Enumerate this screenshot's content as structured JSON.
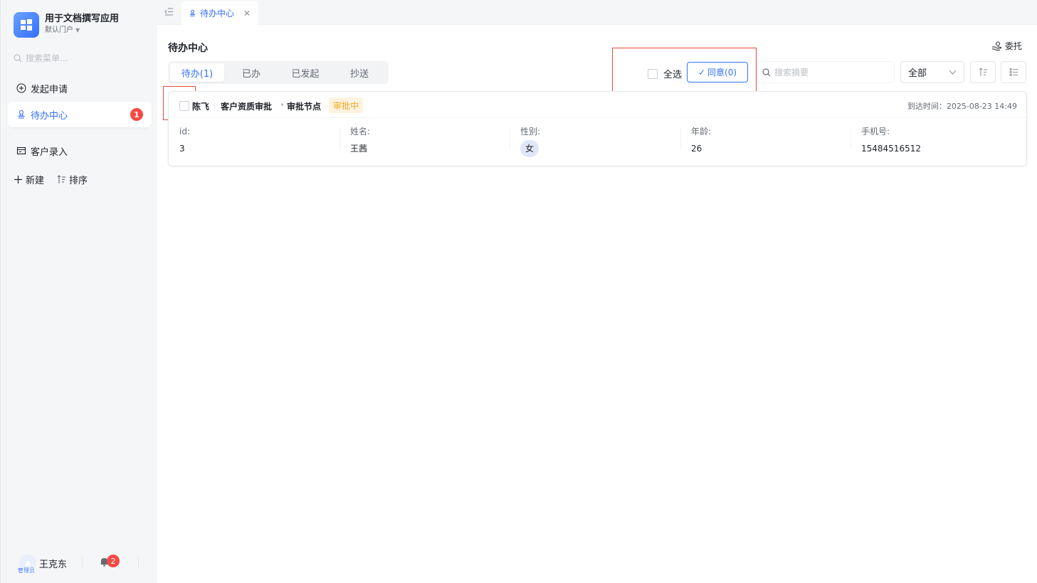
{
  "app": {
    "name": "用于文档撰写应用",
    "portal": "默认门户"
  },
  "sidebar": {
    "search_placeholder": "搜索菜单...",
    "items": [
      {
        "label": "发起申请",
        "icon": "plus-circle-icon"
      },
      {
        "label": "待办中心",
        "icon": "stamp-icon",
        "badge": "1",
        "active": true
      },
      {
        "label": "客户录入",
        "icon": "form-icon"
      }
    ],
    "actions": [
      {
        "label": "新建",
        "icon": "plus-icon"
      },
      {
        "label": "排序",
        "icon": "sort-icon"
      }
    ],
    "footer": {
      "user_name": "王克东",
      "role": "管理员",
      "notification_count": "2"
    }
  },
  "tabbar": {
    "open_tab": "待办中心"
  },
  "main": {
    "title": "待办中心",
    "delegate_label": "委托",
    "segments": [
      {
        "label": "待办(1)",
        "active": true
      },
      {
        "label": "已办"
      },
      {
        "label": "已发起"
      },
      {
        "label": "抄送"
      }
    ],
    "select_all_label": "全选",
    "agree_label": "同意(0)",
    "search_placeholder": "搜索摘要",
    "filter_value": "全部",
    "card": {
      "initiator": "陈飞",
      "flow_name": "客户资质审批",
      "node_name": "审批节点",
      "status": "审批中",
      "arrive_time": "到达时间：2025-08-23 14:49",
      "fields": [
        {
          "label": "id:",
          "value": "3"
        },
        {
          "label": "姓名:",
          "value": "王茜"
        },
        {
          "label": "性别:",
          "value": "女"
        },
        {
          "label": "年龄:",
          "value": "26"
        },
        {
          "label": "手机号:",
          "value": "15484516512"
        }
      ]
    }
  },
  "colors": {
    "accent": "#3370ff",
    "danger": "#f54a45",
    "status_pending": "#f5a623",
    "highlight": "#e8483f"
  }
}
